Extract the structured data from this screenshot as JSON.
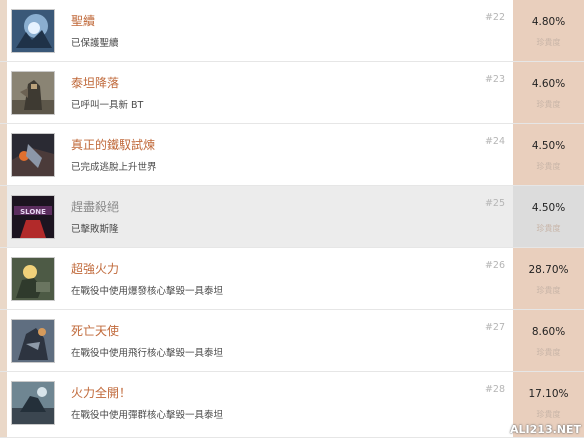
{
  "achievements": [
    {
      "title": "聖續",
      "description": "已保護聖續",
      "number": "#22",
      "percent": "4.80%",
      "rarity_label": "珍貴度"
    },
    {
      "title": "泰坦降落",
      "description": "已呼叫一具新 BT",
      "number": "#23",
      "percent": "4.60%",
      "rarity_label": "珍貴度"
    },
    {
      "title": "真正的鐵馭試煉",
      "description": "已完成逃脫上升世界",
      "number": "#24",
      "percent": "4.50%",
      "rarity_label": "珍貴度"
    },
    {
      "title": "趕盡殺絕",
      "description": "已擊敗斯隆",
      "number": "#25",
      "percent": "4.50%",
      "rarity_label": "珍貴度"
    },
    {
      "title": "超強火力",
      "description": "在戰役中使用爆發核心擊毀一具泰坦",
      "number": "#26",
      "percent": "28.70%",
      "rarity_label": "珍貴度"
    },
    {
      "title": "死亡天使",
      "description": "在戰役中使用飛行核心擊毀一具泰坦",
      "number": "#27",
      "percent": "8.60%",
      "rarity_label": "珍貴度"
    },
    {
      "title": "火力全開！",
      "description": "在戰役中使用彈群核心擊毀一具泰坦",
      "number": "#28",
      "percent": "17.10%",
      "rarity_label": "珍貴度"
    }
  ],
  "watermark": "ALI213.NET",
  "colors": {
    "title": "#c0693a",
    "rarity_bg": "#e9cfbd",
    "locked_bg": "#ececec"
  }
}
